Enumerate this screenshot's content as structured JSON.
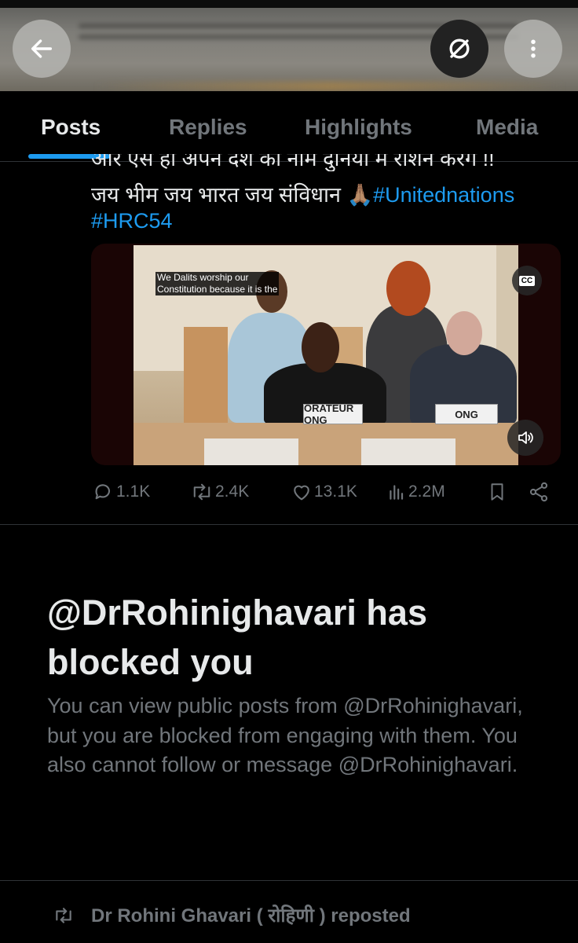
{
  "header": {
    "back_icon": "arrow-left-icon",
    "mute_icon": "volume-off-icon",
    "more_icon": "more-vertical-icon"
  },
  "tabs": [
    {
      "label": "Posts",
      "active": true
    },
    {
      "label": "Replies",
      "active": false
    },
    {
      "label": "Highlights",
      "active": false
    },
    {
      "label": "Media",
      "active": false
    }
  ],
  "tweet": {
    "line_clipped": "और ऐसे ही अपने देश का नाम दुनिया में रोशन करेंगे !!",
    "line2_text": "जय भीम जय भारत जय संविधान 🙏🏽",
    "hashtag1": "#Unitednations",
    "hashtag2": "#HRC54",
    "video": {
      "caption_line1": "We Dalits worship our",
      "caption_line2": "Constitution because it is the",
      "cc_label": "CC",
      "nameplate1": "ORATEUR ONG",
      "nameplate2": "ONG"
    },
    "actions": {
      "replies": "1.1K",
      "reposts": "2.4K",
      "likes": "13.1K",
      "views": "2.2M"
    }
  },
  "blocked": {
    "title": "@DrRohinighavari has blocked you",
    "description": "You can view public posts from @DrRohinighavari, but you are blocked from engaging with them. You also cannot follow or message @DrRohinighavari."
  },
  "repost_line": {
    "text": "Dr Rohini Ghavari ( रोहिणी ) reposted"
  },
  "colors": {
    "accent": "#1d9bf0",
    "muted": "#71767b",
    "text": "#e7e9ea",
    "background": "#000000"
  }
}
